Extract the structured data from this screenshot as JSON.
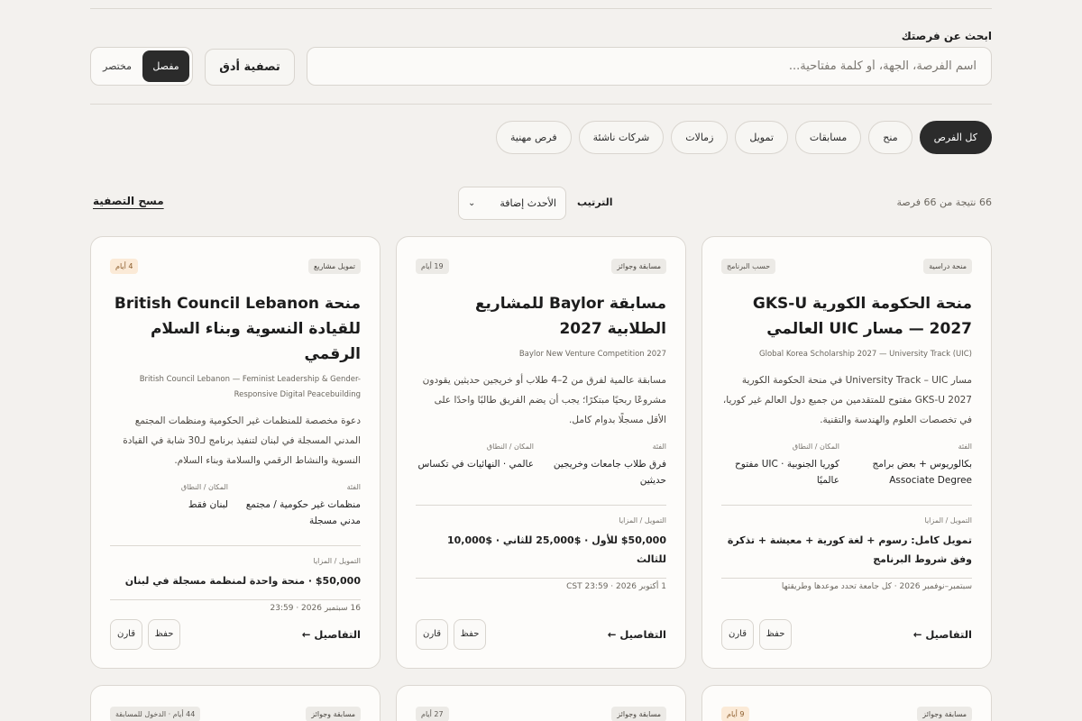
{
  "search": {
    "label": "ابحث عن فرصتك",
    "placeholder": "اسم الفرصة، الجهة، أو كلمة مفتاحية...",
    "refine_label": "تصفية أدق",
    "view_detailed": "مفصل",
    "view_compact": "مختصر"
  },
  "filters": [
    {
      "label": "كل الفرص",
      "active": true
    },
    {
      "label": "منح"
    },
    {
      "label": "مسابقات"
    },
    {
      "label": "تمويل"
    },
    {
      "label": "زمالات"
    },
    {
      "label": "شركات ناشئة"
    },
    {
      "label": "فرص مهنية"
    }
  ],
  "results": {
    "count_text": "66 نتيجة من 66 فرصة",
    "sort_label": "الترتيب",
    "sort_value": "الأحدث إضافة",
    "clear_label": "مسح التصفية"
  },
  "cards": [
    {
      "type_badge": "منحة دراسية",
      "status_badge": "حسب البرنامج",
      "title": "منحة الحكومة الكورية GKS-U 2027 — مسار UIC العالمي",
      "subtitle": "Global Korea Scholarship 2027 — University Track (UIC)",
      "description": "مسار University Track – UIC في منحة الحكومة الكورية GKS-U 2027 مفتوح للمتقدمين من جميع دول العالم غير كوريا، في تخصصات العلوم والهندسة والتقنية.",
      "category_label": "الفئة",
      "category_value": "بكالوريوس + بعض برامج Associate Degree",
      "location_label": "المكان / النطاق",
      "location_value": "كوريا الجنوبية · UIC مفتوح عالميًا",
      "funding_label": "التمويل / المزايا",
      "funding_value": "تمويل كامل: رسوم + لغة كورية + معيشة + تذكرة وفق شروط البرنامج",
      "deadline": "سبتمبر–نوفمبر 2026 · كل جامعة تحدد موعدها وطريقتها",
      "details_label": "التفاصيل ←",
      "save_label": "حفظ",
      "compare_label": "قارن"
    },
    {
      "type_badge": "مسابقة وجوائز",
      "status_badge": "19 أيام",
      "title": "مسابقة Baylor للمشاريع الطلابية 2027",
      "subtitle": "Baylor New Venture Competition 2027",
      "description": "مسابقة عالمية لفرق من 2–4 طلاب أو خريجين حديثين يقودون مشروعًا ربحيًا مبتكرًا؛ يجب أن يضم الفريق طالبًا واحدًا على الأقل مسجلًا بدوام كامل.",
      "category_label": "الفئة",
      "category_value": "فرق طلاب جامعات وخريجين حديثين",
      "location_label": "المكان / النطاق",
      "location_value": "عالمي · النهائيات في تكساس",
      "funding_label": "التمويل / المزايا",
      "funding_value": "$50,000 للأول · $25,000 للثاني · $10,000 للثالث",
      "deadline": "1 أكتوبر 2026 · 23:59 CST",
      "details_label": "التفاصيل ←",
      "save_label": "حفظ",
      "compare_label": "قارن"
    },
    {
      "type_badge": "تمويل مشاريع",
      "status_badge": "4 أيام",
      "title": "منحة British Council Lebanon للقيادة النسوية وبناء السلام الرقمي",
      "subtitle": "British Council Lebanon — Feminist Leadership & Gender-Responsive Digital Peacebuilding",
      "description": "دعوة مخصصة للمنظمات غير الحكومية ومنظمات المجتمع المدني المسجلة في لبنان لتنفيذ برنامج لـ30 شابة في القيادة النسوية والنشاط الرقمي والسلامة وبناء السلام.",
      "category_label": "الفئة",
      "category_value": "منظمات غير حكومية / مجتمع مدني مسجلة",
      "location_label": "المكان / النطاق",
      "location_value": "لبنان فقط",
      "funding_label": "التمويل / المزايا",
      "funding_value": "$50,000 · منحة واحدة لمنظمة مسجلة في لبنان",
      "deadline": "16 سبتمبر 2026 · 23:59",
      "details_label": "التفاصيل ←",
      "save_label": "حفظ",
      "compare_label": "قارن"
    }
  ],
  "next_row": [
    {
      "type_badge": "مسابقة وجوائز",
      "status_badge": "9 أيام"
    },
    {
      "type_badge": "مسابقة وجوائز",
      "status_badge": "27 أيام"
    },
    {
      "type_badge": "مسابقة وجوائز",
      "status_badge": "44 أيام · الدخول للمسابقة"
    }
  ],
  "colors": {
    "background": "#f3f1ee",
    "card": "#fdfcfa",
    "accent_dark": "#2b2b2b",
    "warn_badge": "#fbead7"
  }
}
